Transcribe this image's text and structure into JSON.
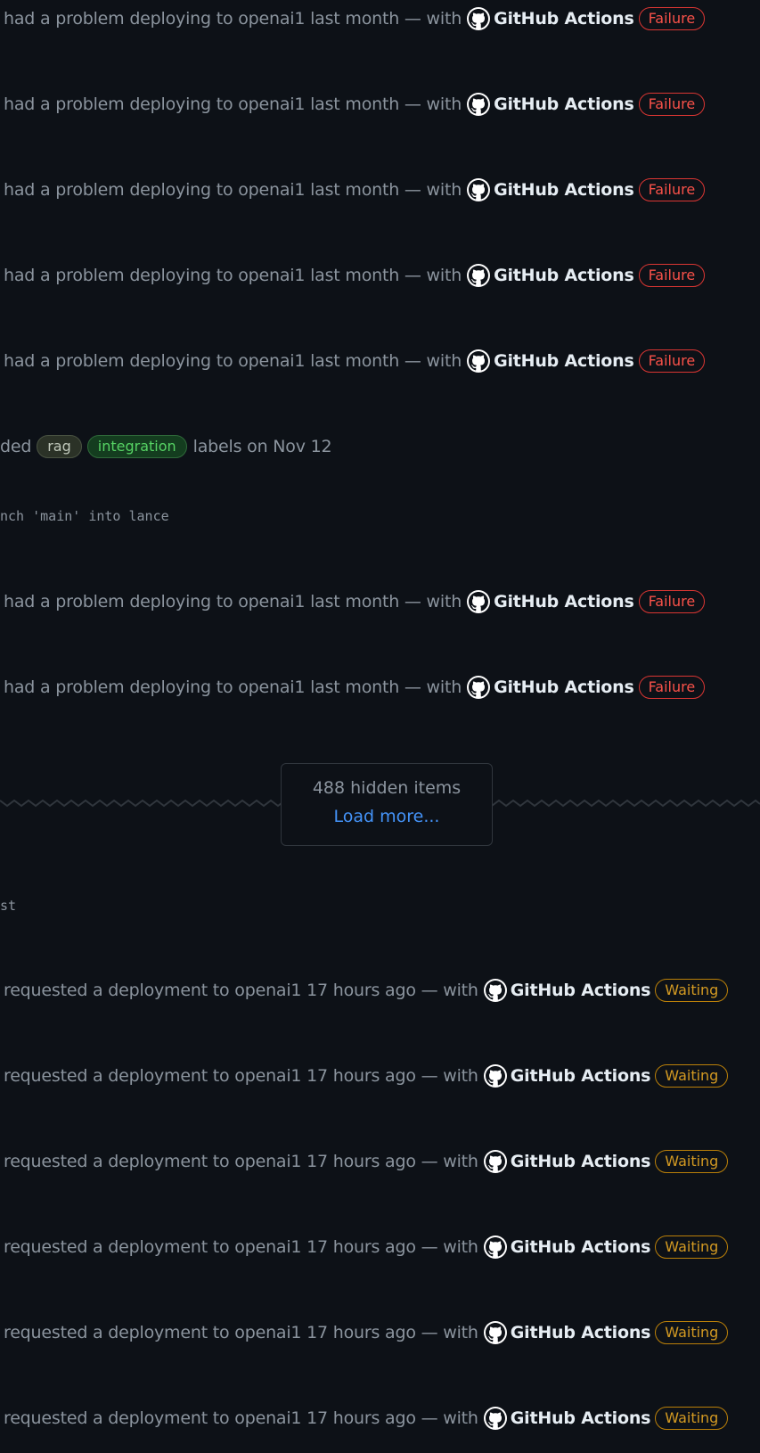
{
  "colors": {
    "background": "#0d1117",
    "muted_text": "#8b949e",
    "actor_text": "#e6edf3",
    "failure": "#f85149",
    "waiting": "#d29922",
    "link": "#4493f8"
  },
  "events_top": [
    {
      "text": "had a problem deploying to openai1 last month — with",
      "actor": "GitHub Actions",
      "status": "Failure",
      "icon": "github-mark-icon"
    },
    {
      "text": "had a problem deploying to openai1 last month — with",
      "actor": "GitHub Actions",
      "status": "Failure",
      "icon": "github-mark-icon"
    },
    {
      "text": "had a problem deploying to openai1 last month — with",
      "actor": "GitHub Actions",
      "status": "Failure",
      "icon": "github-mark-icon"
    },
    {
      "text": "had a problem deploying to openai1 last month — with",
      "actor": "GitHub Actions",
      "status": "Failure",
      "icon": "github-mark-icon"
    },
    {
      "text": "had a problem deploying to openai1 last month — with",
      "actor": "GitHub Actions",
      "status": "Failure",
      "icon": "github-mark-icon"
    }
  ],
  "label_event": {
    "prefix": "ded",
    "labels": [
      "rag",
      "integration"
    ],
    "suffix": "labels on Nov 12"
  },
  "commit_line": "nch 'main' into lance",
  "events_mid": [
    {
      "text": "had a problem deploying to openai1 last month — with",
      "actor": "GitHub Actions",
      "status": "Failure",
      "icon": "github-mark-icon"
    },
    {
      "text": "had a problem deploying to openai1 last month — with",
      "actor": "GitHub Actions",
      "status": "Failure",
      "icon": "github-mark-icon"
    }
  ],
  "hidden_items": {
    "count_text": "488 hidden items",
    "load_more": "Load more..."
  },
  "fragment_line": "st",
  "events_bottom": [
    {
      "text": "requested a deployment to openai1 17 hours ago — with",
      "actor": "GitHub Actions",
      "status": "Waiting",
      "icon": "github-mark-icon"
    },
    {
      "text": "requested a deployment to openai1 17 hours ago — with",
      "actor": "GitHub Actions",
      "status": "Waiting",
      "icon": "github-mark-icon"
    },
    {
      "text": "requested a deployment to openai1 17 hours ago — with",
      "actor": "GitHub Actions",
      "status": "Waiting",
      "icon": "github-mark-icon"
    },
    {
      "text": "requested a deployment to openai1 17 hours ago — with",
      "actor": "GitHub Actions",
      "status": "Waiting",
      "icon": "github-mark-icon"
    },
    {
      "text": "requested a deployment to openai1 17 hours ago — with",
      "actor": "GitHub Actions",
      "status": "Waiting",
      "icon": "github-mark-icon"
    },
    {
      "text": "requested a deployment to openai1 17 hours ago — with",
      "actor": "GitHub Actions",
      "status": "Waiting",
      "icon": "github-mark-icon"
    }
  ]
}
